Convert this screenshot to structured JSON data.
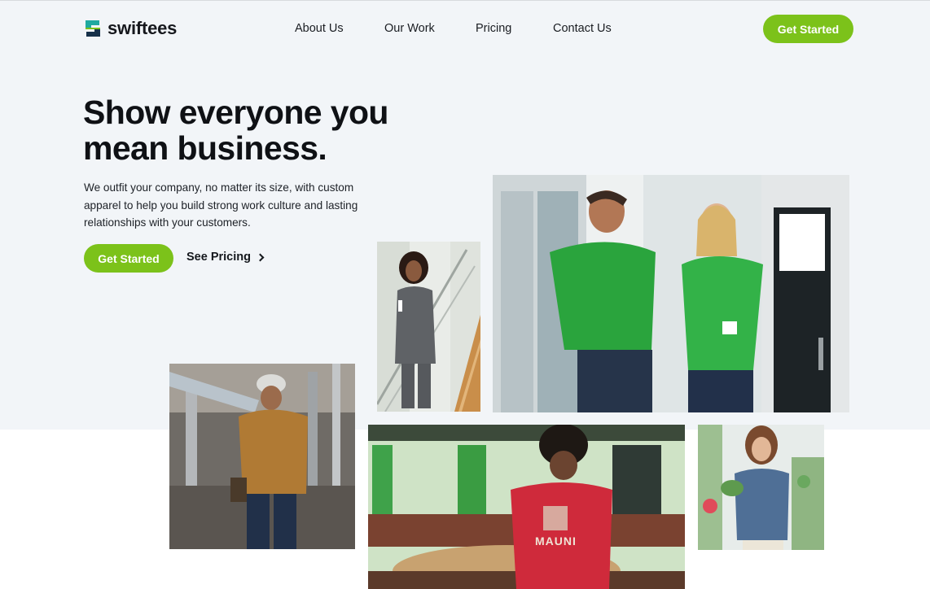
{
  "brand": {
    "name": "swiftees",
    "accent": "#7cc21a",
    "logo_teal": "#1fa9a0",
    "logo_navy": "#17314a"
  },
  "nav": {
    "items": [
      {
        "label": "About Us"
      },
      {
        "label": "Our Work"
      },
      {
        "label": "Pricing"
      },
      {
        "label": "Contact Us"
      }
    ],
    "cta_label": "Get Started"
  },
  "hero": {
    "headline": "Show everyone you mean business.",
    "subcopy": "We outfit your company, no matter its size, with custom apparel to help you build strong work culture and lasting relationships with your customers.",
    "primary_cta": "Get Started",
    "secondary_cta": "See Pricing",
    "secondary_icon": "chevron-right-icon"
  },
  "photos": [
    {
      "name": "photo-scrubs-woman-staircase"
    },
    {
      "name": "photo-green-polo-couple"
    },
    {
      "name": "photo-construction-worker"
    },
    {
      "name": "photo-bartender-red-shirt",
      "shirt_text": "MAUNI"
    },
    {
      "name": "photo-denim-shirt-greenhouse"
    }
  ]
}
